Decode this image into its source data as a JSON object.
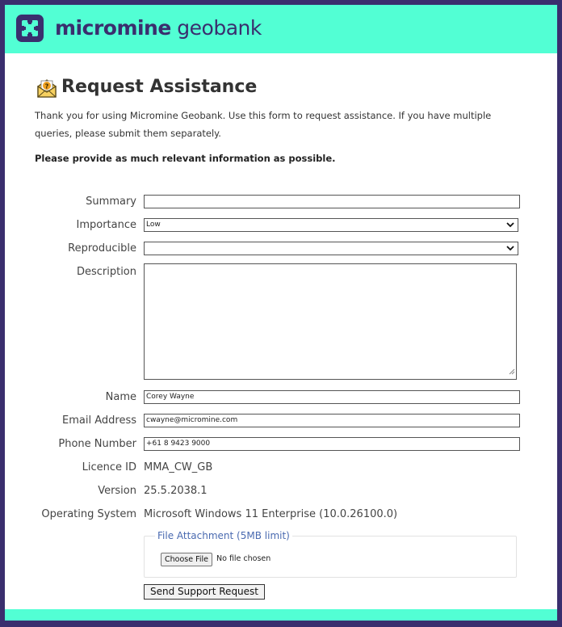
{
  "header": {
    "brand_bold": "micromine",
    "brand_light": " geobank",
    "logo_icon": "micromine-logo-icon"
  },
  "page": {
    "title": "Request Assistance",
    "title_icon": "help-envelope-icon",
    "intro": "Thank you for using Micromine Geobank. Use this form to request assistance. If you have multiple queries, please submit them separately.",
    "emphasis": "Please provide as much relevant information as possible."
  },
  "form": {
    "summary": {
      "label": "Summary",
      "value": ""
    },
    "importance": {
      "label": "Importance",
      "value": "Low"
    },
    "reproducible": {
      "label": "Reproducible",
      "value": ""
    },
    "description": {
      "label": "Description",
      "value": ""
    },
    "name": {
      "label": "Name",
      "value": "Corey Wayne"
    },
    "email": {
      "label": "Email Address",
      "value": "cwayne@micromine.com"
    },
    "phone": {
      "label": "Phone Number",
      "value": "+61 8 9423 9000"
    },
    "licence": {
      "label": "Licence ID",
      "value": "MMA_CW_GB"
    },
    "version": {
      "label": "Version",
      "value": "25.5.2038.1"
    },
    "os": {
      "label": "Operating System",
      "value": "Microsoft Windows 11 Enterprise (10.0.26100.0)"
    },
    "attachment": {
      "legend": "File Attachment (5MB limit)",
      "choose_label": "Choose File",
      "status": "No file chosen"
    },
    "submit_label": "Send Support Request"
  },
  "colors": {
    "brand_purple": "#3a2e6e",
    "brand_mint": "#52ffd4",
    "legend_blue": "#4a6ab0"
  }
}
